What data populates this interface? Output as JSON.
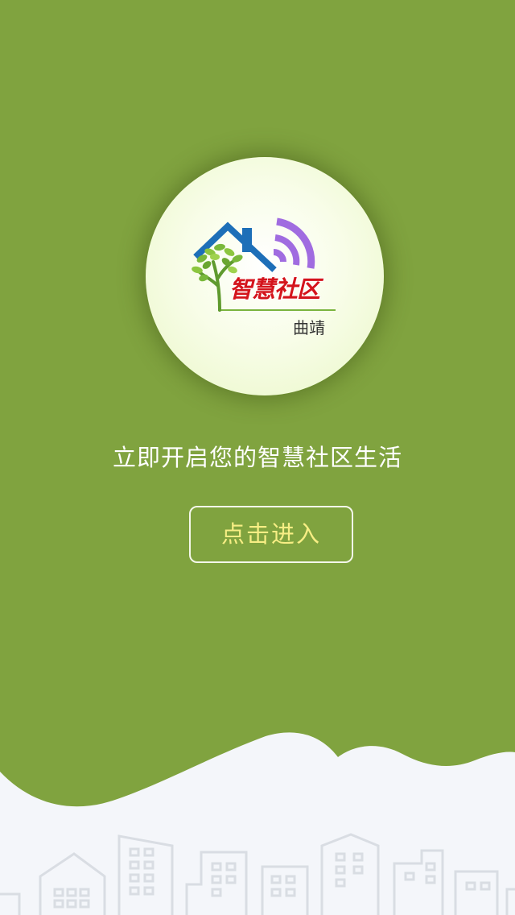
{
  "logo": {
    "brand_text": "智慧社区",
    "city_text": "曲靖",
    "icons": [
      "house-roof-icon",
      "tree-icon",
      "wifi-signal-icon"
    ]
  },
  "tagline": "立即开启您的智慧社区生活",
  "enter_button": {
    "label": "点击进入"
  },
  "colors": {
    "background": "#80a33f",
    "button_text": "#f7ee84",
    "brand_red": "#d4141c",
    "roof_blue": "#1d6fb8",
    "signal_purple": "#a06ce0",
    "footer_bg": "#f4f6fa"
  }
}
